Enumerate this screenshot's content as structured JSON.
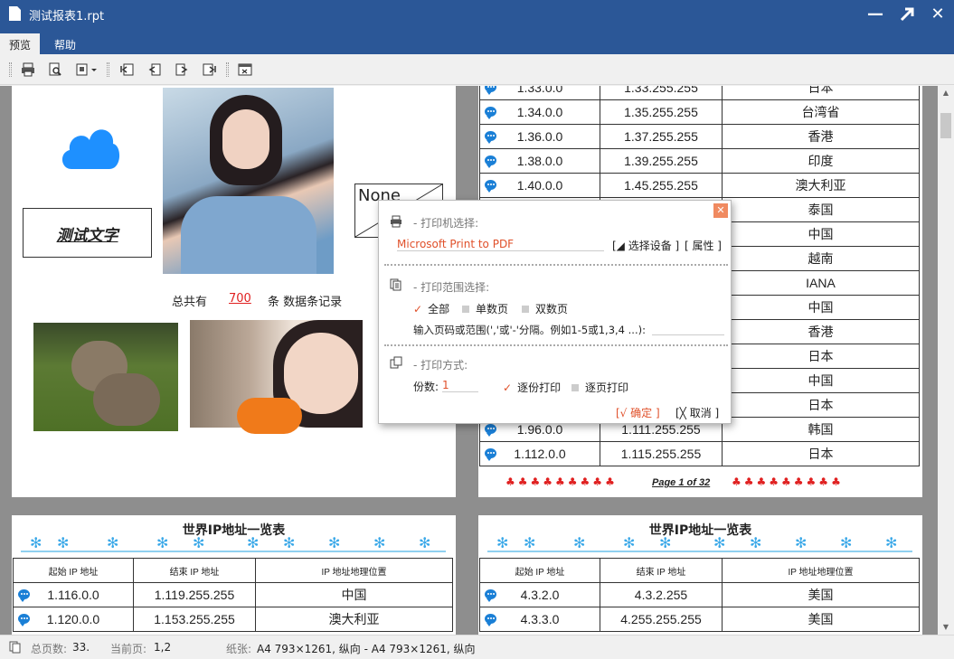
{
  "window": {
    "title": "测试报表1.rpt"
  },
  "menu": {
    "items": [
      "预览",
      "帮助"
    ]
  },
  "page1": {
    "text_box": "测试文字",
    "summary_prefix": "总共有",
    "summary_count": "700",
    "summary_suffix": "条 数据条记录",
    "none_label": "None"
  },
  "page2": {
    "rows": [
      {
        "start": "1.33.0.0",
        "end": "1.33.255.255",
        "loc": "日本"
      },
      {
        "start": "1.34.0.0",
        "end": "1.35.255.255",
        "loc": "台湾省"
      },
      {
        "start": "1.36.0.0",
        "end": "1.37.255.255",
        "loc": "香港"
      },
      {
        "start": "1.38.0.0",
        "end": "1.39.255.255",
        "loc": "印度"
      },
      {
        "start": "1.40.0.0",
        "end": "1.45.255.255",
        "loc": "澳大利亚"
      },
      {
        "start": "",
        "end": "",
        "loc": "泰国"
      },
      {
        "start": "",
        "end": "",
        "loc": "中国"
      },
      {
        "start": "",
        "end": "",
        "loc": "越南"
      },
      {
        "start": "",
        "end": "",
        "loc": "IANA"
      },
      {
        "start": "",
        "end": "",
        "loc": "中国"
      },
      {
        "start": "",
        "end": "",
        "loc": "香港"
      },
      {
        "start": "",
        "end": "",
        "loc": "日本"
      },
      {
        "start": "",
        "end": "",
        "loc": "中国"
      },
      {
        "start": "",
        "end": "",
        "loc": "日本"
      },
      {
        "start": "1.96.0.0",
        "end": "1.111.255.255",
        "loc": "韩国"
      },
      {
        "start": "1.112.0.0",
        "end": "1.115.255.255",
        "loc": "日本"
      }
    ],
    "page_label": "Page 1 of 32"
  },
  "page3": {
    "title": "世界IP地址一览表",
    "headers": [
      "起始 IP 地址",
      "结束 IP 地址",
      "IP 地址地理位置"
    ],
    "rows": [
      {
        "start": "1.116.0.0",
        "end": "1.119.255.255",
        "loc": "中国"
      },
      {
        "start": "1.120.0.0",
        "end": "1.153.255.255",
        "loc": "澳大利亚"
      }
    ]
  },
  "page4": {
    "title": "世界IP地址一览表",
    "headers": [
      "起始 IP 地址",
      "结束 IP 地址",
      "IP 地址地理位置"
    ],
    "rows": [
      {
        "start": "4.3.2.0",
        "end": "4.3.2.255",
        "loc": "美国"
      },
      {
        "start": "4.3.3.0",
        "end": "4.255.255.255",
        "loc": "美国"
      }
    ]
  },
  "dialog": {
    "printer_section": "- 打印机选择:",
    "printer_name": "Microsoft Print to PDF",
    "select_device": "[◢ 选择设备 ]",
    "properties": "[ 属性 ]",
    "range_section": "- 打印范围选择:",
    "range_all": "全部",
    "range_odd": "单数页",
    "range_even": "双数页",
    "range_input_label": "输入页码或范围(','或'-'分隔。例如1-5或1,3,4 ...):",
    "mode_section": "- 打印方式:",
    "copies_label": "份数:",
    "copies_value": "1",
    "collate": "逐份打印",
    "per_page": "逐页打印",
    "ok": "[√ 确定 ]",
    "cancel": "[╳ 取消 ]"
  },
  "status": {
    "total_label": "总页数:",
    "total_value": "33.",
    "current_label": "当前页:",
    "current_value": "1,2",
    "paper_label": "纸张:",
    "paper_value": "A4  793×1261, 纵向  -  A4  793×1261, 纵向"
  },
  "colors": {
    "titlebar": "#2b5797",
    "accent_red": "#e0502a",
    "chat_blue": "#1a7fd6"
  }
}
